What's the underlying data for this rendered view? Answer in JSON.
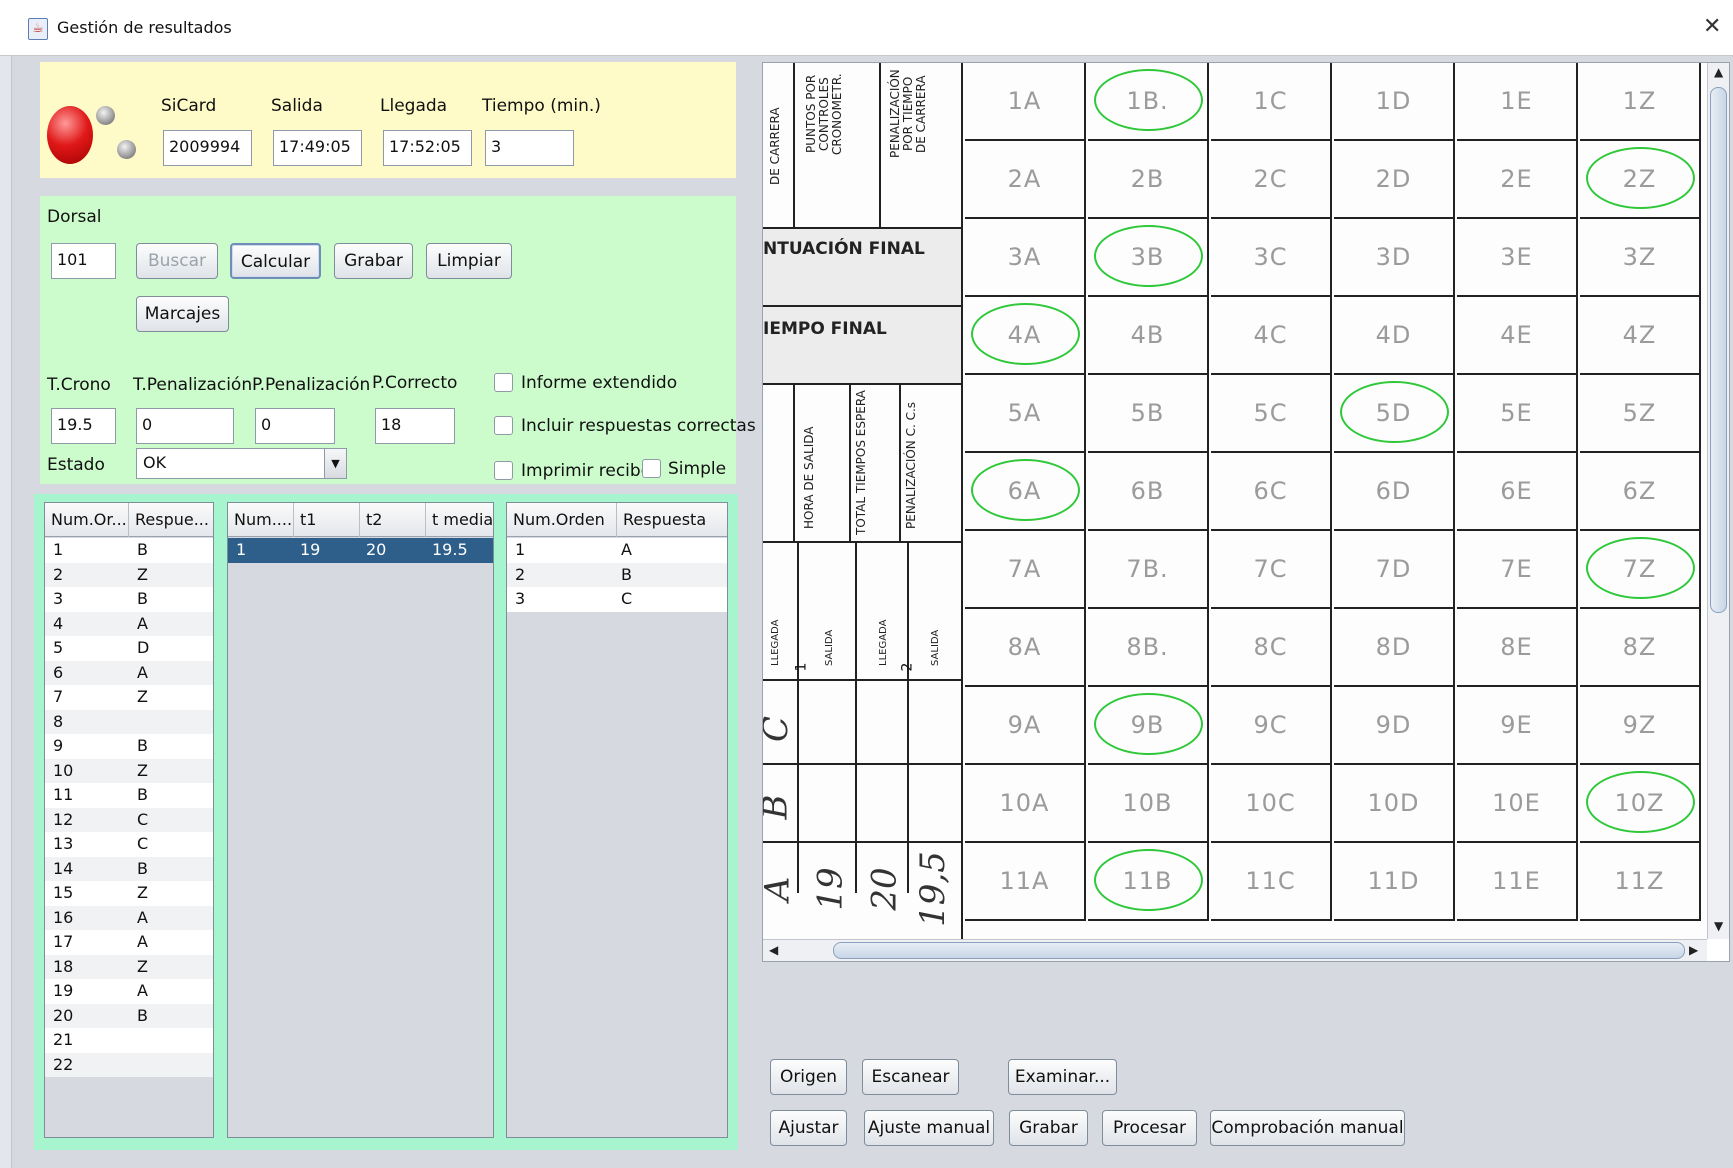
{
  "window": {
    "title": "Gestión de resultados",
    "close_label": "✕"
  },
  "card": {
    "sicard_label": "SiCard",
    "sicard_value": "2009994",
    "salida_label": "Salida",
    "salida_value": "17:49:05",
    "llegada_label": "Llegada",
    "llegada_value": "17:52:05",
    "tiempo_label": "Tiempo (min.)",
    "tiempo_value": "3"
  },
  "dorsal": {
    "label": "Dorsal",
    "value": "101",
    "buscar": "Buscar",
    "calcular": "Calcular",
    "grabar": "Grabar",
    "limpiar": "Limpiar",
    "marcajes": "Marcajes"
  },
  "scores": {
    "tcrono_label": "T.Crono",
    "tcrono_value": "19.5",
    "tpen_label": "T.Penalización",
    "tpen_value": "0",
    "ppen_label": "P.Penalización",
    "ppen_value": "0",
    "pcorrecto_label": "P.Correcto",
    "pcorrecto_value": "18",
    "estado_label": "Estado",
    "estado_value": "OK"
  },
  "options": {
    "informe": "Informe extendido",
    "incluir": "Incluir respuestas correctas",
    "imprimir": "Imprimir recibo",
    "simple": "Simple"
  },
  "table1": {
    "headers": [
      "Num.Or...",
      "Respue..."
    ],
    "rows": [
      [
        "1",
        "B"
      ],
      [
        "2",
        "Z"
      ],
      [
        "3",
        "B"
      ],
      [
        "4",
        "A"
      ],
      [
        "5",
        "D"
      ],
      [
        "6",
        "A"
      ],
      [
        "7",
        "Z"
      ],
      [
        "8",
        ""
      ],
      [
        "9",
        "B"
      ],
      [
        "10",
        "Z"
      ],
      [
        "11",
        "B"
      ],
      [
        "12",
        "C"
      ],
      [
        "13",
        "C"
      ],
      [
        "14",
        "B"
      ],
      [
        "15",
        "Z"
      ],
      [
        "16",
        "A"
      ],
      [
        "17",
        "A"
      ],
      [
        "18",
        "Z"
      ],
      [
        "19",
        "A"
      ],
      [
        "20",
        "B"
      ],
      [
        "21",
        ""
      ],
      [
        "22",
        ""
      ]
    ]
  },
  "table2": {
    "headers": [
      "Num....",
      "t1",
      "t2",
      "t media"
    ],
    "rows": [
      [
        "1",
        "19",
        "20",
        "19.5"
      ]
    ]
  },
  "table3": {
    "headers": [
      "Num.Orden",
      "Respuesta"
    ],
    "rows": [
      [
        "1",
        "A"
      ],
      [
        "2",
        "B"
      ],
      [
        "3",
        "C"
      ]
    ]
  },
  "sheet": {
    "side_labels": {
      "puntuacion": "NTUACIÓN FINAL",
      "tiempo": "IEMPO FINAL",
      "de_carrera": "DE CARRERA",
      "puntos": "PUNTOS POR CONTROLES CRONOMETR.",
      "penalizacion": "PENALIZACIÓN POR TIEMPO DE CARRERA",
      "hora_salida": "HORA DE SALIDA",
      "total_tiempos": "TOTAL TIEMPOS ESPERA",
      "penalizacion_cs": "PENALIZACIÓN C. C.s",
      "llegada1": "LLEGADA",
      "salida1": "SALIDA",
      "llegada2": "LLEGADA",
      "salida2": "SALIDA",
      "num1": "1",
      "num2": "2"
    },
    "handwriting": {
      "c": "C",
      "b": "B",
      "a": "A",
      "t1": "19",
      "t2": "20",
      "tm": "19,5"
    },
    "columns": [
      "A",
      "B",
      "C",
      "D",
      "E",
      "Z"
    ],
    "grid": [
      [
        "1A",
        "1B.",
        "1C",
        "1D",
        "1E",
        "1Z"
      ],
      [
        "2A",
        "2B",
        "2C",
        "2D",
        "2E",
        "2Z"
      ],
      [
        "3A",
        "3B",
        "3C",
        "3D",
        "3E",
        "3Z"
      ],
      [
        "4A",
        "4B",
        "4C",
        "4D",
        "4E",
        "4Z"
      ],
      [
        "5A",
        "5B",
        "5C",
        "5D",
        "5E",
        "5Z"
      ],
      [
        "6A",
        "6B",
        "6C",
        "6D",
        "6E",
        "6Z"
      ],
      [
        "7A",
        "7B.",
        "7C",
        "7D",
        "7E",
        "7Z"
      ],
      [
        "8A",
        "8B.",
        "8C",
        "8D",
        "8E",
        "8Z"
      ],
      [
        "9A",
        "9B",
        "9C",
        "9D",
        "9E",
        "9Z"
      ],
      [
        "10A",
        "10B",
        "10C",
        "10D",
        "10E",
        "10Z"
      ],
      [
        "11A",
        "11B",
        "11C",
        "11D",
        "11E",
        "11Z"
      ]
    ],
    "circled": [
      "1B.",
      "2Z",
      "3B",
      "4A",
      "5D",
      "6A",
      "7Z",
      "9B",
      "10Z",
      "11B"
    ]
  },
  "bottom_buttons": {
    "origen": "Origen",
    "escanear": "Escanear",
    "examinar": "Examinar...",
    "ajustar": "Ajustar",
    "ajuste_manual": "Ajuste manual",
    "grabar": "Grabar",
    "procesar": "Procesar",
    "comprobacion": "Comprobación manual"
  },
  "colors": {
    "yellow_panel": "#fefbc8",
    "green_panel": "#ccfbcc",
    "mint_panel": "#a6f5cf",
    "circle": "#2fc83a",
    "selection": "#2e5f8a"
  }
}
